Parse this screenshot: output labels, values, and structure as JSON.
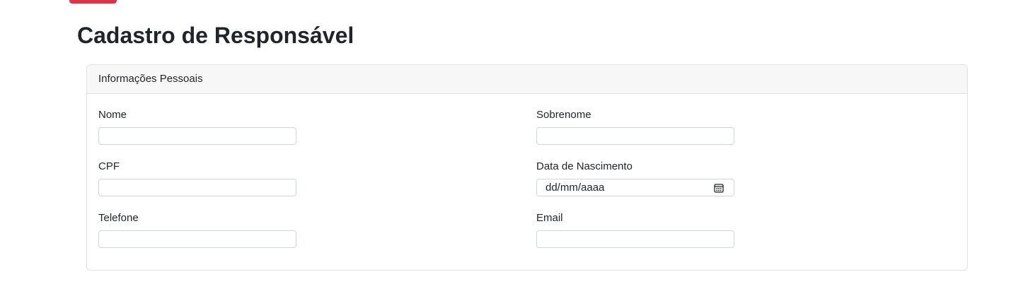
{
  "page": {
    "title": "Cadastro de Responsável"
  },
  "colors": {
    "accent": "#dc3545",
    "border": "#dee2e6",
    "header_bg": "#f7f7f7"
  },
  "card": {
    "header": "Informações Pessoais",
    "fields": {
      "nome": {
        "label": "Nome",
        "value": "",
        "placeholder": ""
      },
      "sobrenome": {
        "label": "Sobrenome",
        "value": "",
        "placeholder": ""
      },
      "cpf": {
        "label": "CPF",
        "value": "",
        "placeholder": ""
      },
      "data_nascimento": {
        "label": "Data de Nascimento",
        "format_hint": "dd/mm/aaaa",
        "icon": "calendar-icon"
      },
      "telefone": {
        "label": "Telefone",
        "value": "",
        "placeholder": ""
      },
      "email": {
        "label": "Email",
        "value": "",
        "placeholder": ""
      }
    }
  }
}
